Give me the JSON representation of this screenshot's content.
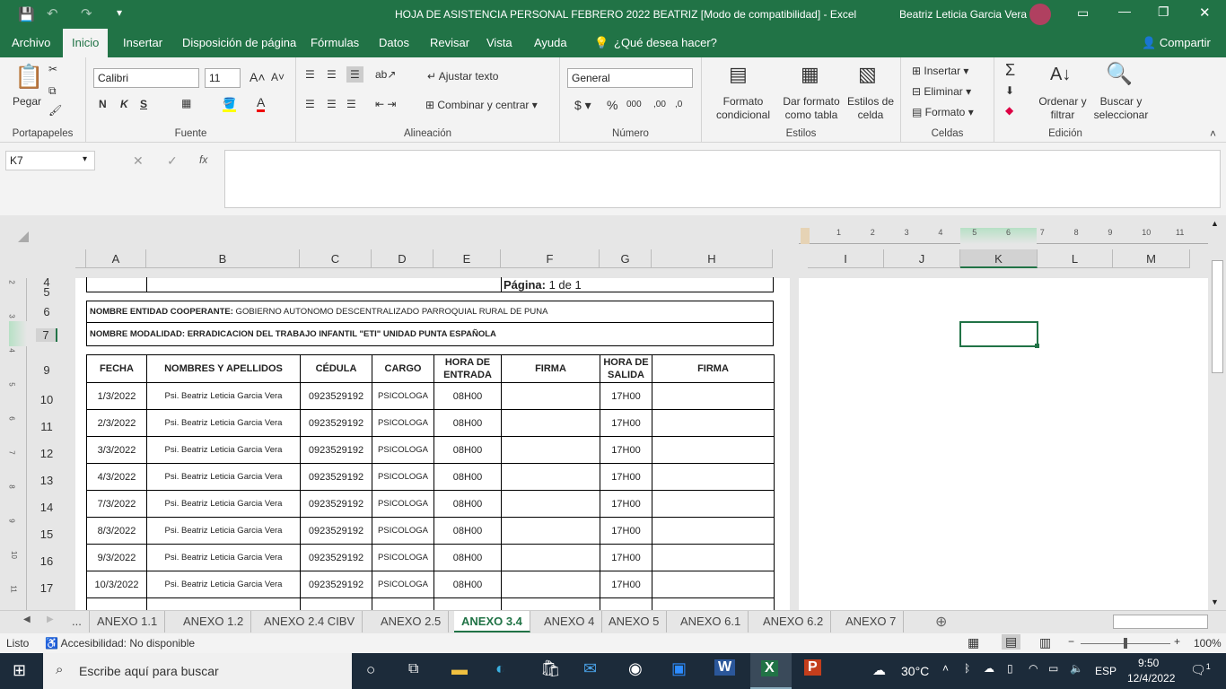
{
  "window": {
    "title": "HOJA DE ASISTENCIA PERSONAL FEBRERO 2022 BEATRIZ  [Modo de compatibilidad]  -  Excel",
    "user": "Beatriz Leticia Garcia Vera"
  },
  "ribbon_tabs": [
    "Archivo",
    "Inicio",
    "Insertar",
    "Disposición de página",
    "Fórmulas",
    "Datos",
    "Revisar",
    "Vista",
    "Ayuda"
  ],
  "tell_me": "¿Qué desea hacer?",
  "share": "Compartir",
  "ribbon": {
    "paste": "Pegar",
    "clipboard": "Portapapeles",
    "font_name": "Calibri",
    "font_size": "11",
    "bold": "N",
    "italic": "K",
    "underline": "S",
    "font": "Fuente",
    "wrap": "Ajustar texto",
    "merge": "Combinar y centrar",
    "alignment": "Alineación",
    "number_format": "General",
    "number": "Número",
    "cond_format": "Formato condicional",
    "format_table": "Dar formato como tabla",
    "cell_styles": "Estilos de celda",
    "styles": "Estilos",
    "insert": "Insertar",
    "delete": "Eliminar",
    "format": "Formato",
    "cells": "Celdas",
    "sort": "Ordenar y filtrar",
    "find": "Buscar y seleccionar",
    "editing": "Edición"
  },
  "formula_bar": {
    "name_box": "K7",
    "fx": "fx",
    "value": ""
  },
  "columns_p1": [
    "A",
    "B",
    "C",
    "D",
    "E",
    "F",
    "G",
    "H"
  ],
  "columns_p2": [
    "I",
    "J",
    "K",
    "L",
    "M"
  ],
  "ruler": [
    "1",
    "2",
    "3",
    "4",
    "5",
    "6",
    "7",
    "8",
    "9",
    "10",
    "11"
  ],
  "vruler": [
    "2",
    "3",
    "4",
    "5",
    "6",
    "7",
    "8",
    "9",
    "10",
    "11"
  ],
  "sheet": {
    "page_label": "Página:",
    "page_value": "1 de 1",
    "entidad_label": "NOMBRE ENTIDAD COOPERANTE:",
    "entidad_value": " GOBIERNO AUTONOMO DESCENTRALIZADO PARROQUIAL RURAL DE PUNA",
    "modalidad": "NOMBRE MODALIDAD: ERRADICACION DEL TRABAJO INFANTIL \"ETI\" UNIDAD PUNTA ESPAÑOLA",
    "headers": [
      "FECHA",
      "NOMBRES  Y APELLIDOS",
      "CÉDULA",
      "CARGO",
      "HORA DE ENTRADA",
      "FIRMA",
      "HORA DE SALIDA",
      "FIRMA"
    ],
    "rows": [
      {
        "row": "10",
        "fecha": "1/3/2022",
        "nombre": "Psi. Beatriz Leticia Garcia Vera",
        "cedula": "0923529192",
        "cargo": "PSICOLOGA",
        "entrada": "08H00",
        "salida": "17H00"
      },
      {
        "row": "11",
        "fecha": "2/3/2022",
        "nombre": "Psi. Beatriz Leticia Garcia Vera",
        "cedula": "0923529192",
        "cargo": "PSICOLOGA",
        "entrada": "08H00",
        "salida": "17H00"
      },
      {
        "row": "12",
        "fecha": "3/3/2022",
        "nombre": "Psi. Beatriz Leticia Garcia Vera",
        "cedula": "0923529192",
        "cargo": "PSICOLOGA",
        "entrada": "08H00",
        "salida": "17H00"
      },
      {
        "row": "13",
        "fecha": "4/3/2022",
        "nombre": "Psi. Beatriz Leticia Garcia Vera",
        "cedula": "0923529192",
        "cargo": "PSICOLOGA",
        "entrada": "08H00",
        "salida": "17H00"
      },
      {
        "row": "14",
        "fecha": "7/3/2022",
        "nombre": "Psi. Beatriz Leticia Garcia Vera",
        "cedula": "0923529192",
        "cargo": "PSICOLOGA",
        "entrada": "08H00",
        "salida": "17H00"
      },
      {
        "row": "15",
        "fecha": "8/3/2022",
        "nombre": "Psi. Beatriz Leticia Garcia Vera",
        "cedula": "0923529192",
        "cargo": "PSICOLOGA",
        "entrada": "08H00",
        "salida": "17H00"
      },
      {
        "row": "16",
        "fecha": "9/3/2022",
        "nombre": "Psi. Beatriz Leticia Garcia Vera",
        "cedula": "0923529192",
        "cargo": "PSICOLOGA",
        "entrada": "08H00",
        "salida": "17H00"
      },
      {
        "row": "17",
        "fecha": "10/3/2022",
        "nombre": "Psi. Beatriz Leticia Garcia Vera",
        "cedula": "0923529192",
        "cargo": "PSICOLOGA",
        "entrada": "08H00",
        "salida": "17H00"
      }
    ],
    "row_numbers_top": [
      "4",
      "5",
      "6",
      "7",
      "9"
    ]
  },
  "sheet_tabs": [
    "...",
    "ANEXO 1.1",
    "ANEXO 1.2",
    "ANEXO 2.4 CIBV",
    "ANEXO 2.5",
    "ANEXO 3.4",
    "ANEXO 4",
    "ANEXO 5",
    "ANEXO 6.1",
    "ANEXO 6.2",
    "ANEXO 7"
  ],
  "active_sheet": "ANEXO 3.4",
  "status": {
    "mode": "Listo",
    "accessibility": "Accesibilidad: No disponible",
    "zoom": "100%"
  },
  "taskbar": {
    "search": "Escribe aquí para buscar",
    "weather": "30°C",
    "lang": "ESP",
    "time": "9:50",
    "date": "12/4/2022",
    "notif": "1"
  },
  "colors": {
    "brand": "#217346"
  }
}
